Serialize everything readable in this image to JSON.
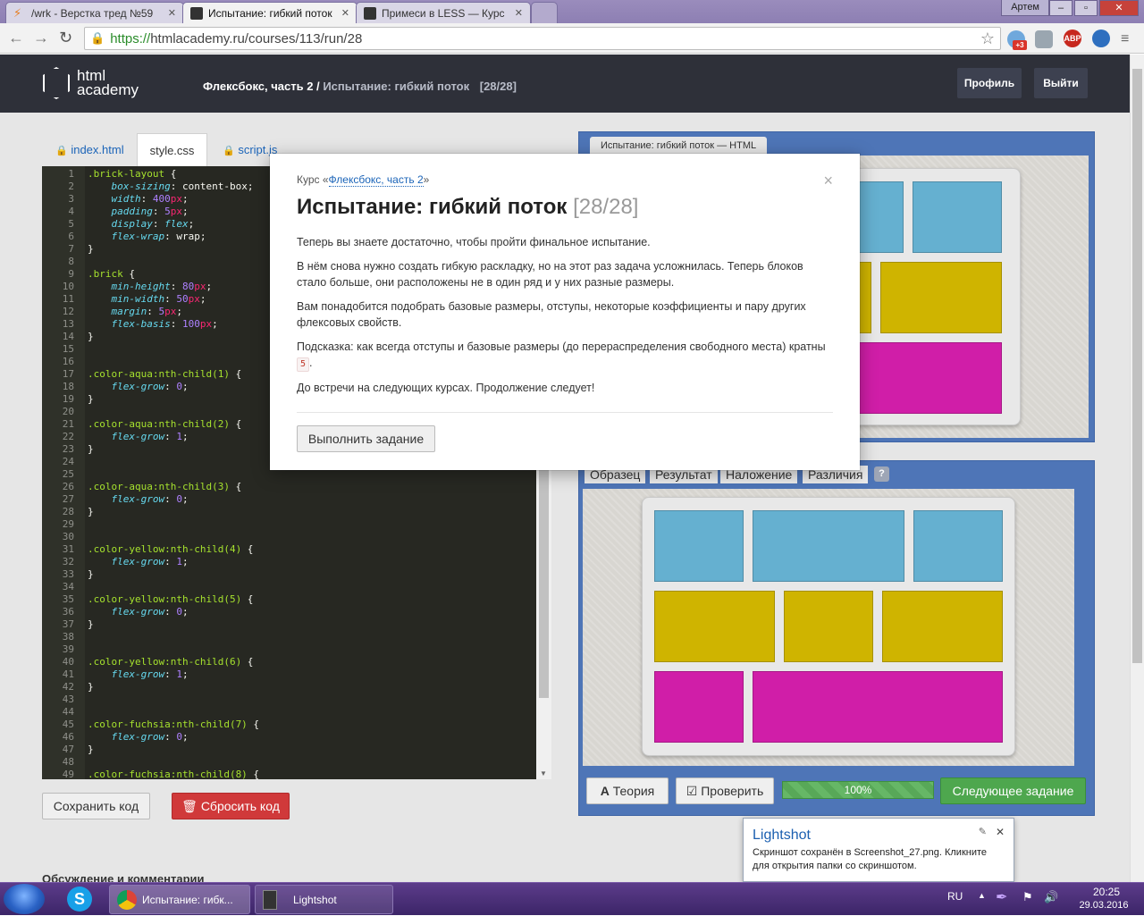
{
  "browser": {
    "tabs": [
      {
        "title": "/wrk - Верстка тред №59",
        "active": false
      },
      {
        "title": "Испытание: гибкий поток",
        "active": true
      },
      {
        "title": "Примеси в LESS — Курс",
        "active": false
      }
    ],
    "user_badge": "Артем",
    "url_https": "https://",
    "url_rest": "htmlacademy.ru/courses/113/run/28",
    "ext_badge": "+3",
    "abp_label": "ABP"
  },
  "site": {
    "logo_line1": "html",
    "logo_line2": "academy",
    "breadcrumb_course": "Флексбокс, часть 2 /",
    "breadcrumb_current": "Испытание: гибкий поток",
    "breadcrumb_count": "[28/28]",
    "profile_label": "Профиль",
    "logout_label": "Выйти"
  },
  "editor": {
    "tabs": [
      {
        "label": "index.html",
        "locked": true,
        "active": false
      },
      {
        "label": "style.css",
        "locked": false,
        "active": true
      },
      {
        "label": "script.js",
        "locked": true,
        "active": false
      }
    ],
    "lines": [
      [
        [
          "sel",
          ".brick-layout"
        ],
        [
          "pun",
          " {"
        ]
      ],
      [
        [
          "pun",
          "    "
        ],
        [
          "prop",
          "box-sizing"
        ],
        [
          "pun",
          ": content-box;"
        ]
      ],
      [
        [
          "pun",
          "    "
        ],
        [
          "prop",
          "width"
        ],
        [
          "pun",
          ": "
        ],
        [
          "num",
          "400"
        ],
        [
          "unit",
          "px"
        ],
        [
          "pun",
          ";"
        ]
      ],
      [
        [
          "pun",
          "    "
        ],
        [
          "prop",
          "padding"
        ],
        [
          "pun",
          ": "
        ],
        [
          "num",
          "5"
        ],
        [
          "unit",
          "px"
        ],
        [
          "pun",
          ";"
        ]
      ],
      [
        [
          "pun",
          "    "
        ],
        [
          "prop",
          "display"
        ],
        [
          "pun",
          ": "
        ],
        [
          "prop",
          "flex"
        ],
        [
          "pun",
          ";"
        ]
      ],
      [
        [
          "pun",
          "    "
        ],
        [
          "prop",
          "flex-wrap"
        ],
        [
          "pun",
          ": wrap;"
        ]
      ],
      [
        [
          "pun",
          "}"
        ]
      ],
      [
        [
          "pun",
          ""
        ]
      ],
      [
        [
          "sel",
          ".brick"
        ],
        [
          "pun",
          " {"
        ]
      ],
      [
        [
          "pun",
          "    "
        ],
        [
          "prop",
          "min-height"
        ],
        [
          "pun",
          ": "
        ],
        [
          "num",
          "80"
        ],
        [
          "unit",
          "px"
        ],
        [
          "pun",
          ";"
        ]
      ],
      [
        [
          "pun",
          "    "
        ],
        [
          "prop",
          "min-width"
        ],
        [
          "pun",
          ": "
        ],
        [
          "num",
          "50"
        ],
        [
          "unit",
          "px"
        ],
        [
          "pun",
          ";"
        ]
      ],
      [
        [
          "pun",
          "    "
        ],
        [
          "prop",
          "margin"
        ],
        [
          "pun",
          ": "
        ],
        [
          "num",
          "5"
        ],
        [
          "unit",
          "px"
        ],
        [
          "pun",
          ";"
        ]
      ],
      [
        [
          "pun",
          "    "
        ],
        [
          "prop",
          "flex-basis"
        ],
        [
          "pun",
          ": "
        ],
        [
          "num",
          "100"
        ],
        [
          "unit",
          "px"
        ],
        [
          "pun",
          ";"
        ]
      ],
      [
        [
          "pun",
          "}"
        ]
      ],
      [
        [
          "pun",
          ""
        ]
      ],
      [
        [
          "pun",
          ""
        ]
      ],
      [
        [
          "sel",
          ".color-aqua:nth-child(1)"
        ],
        [
          "pun",
          " {"
        ]
      ],
      [
        [
          "pun",
          "    "
        ],
        [
          "prop",
          "flex-grow"
        ],
        [
          "pun",
          ": "
        ],
        [
          "num",
          "0"
        ],
        [
          "pun",
          ";"
        ]
      ],
      [
        [
          "pun",
          "}"
        ]
      ],
      [
        [
          "pun",
          ""
        ]
      ],
      [
        [
          "sel",
          ".color-aqua:nth-child(2)"
        ],
        [
          "pun",
          " {"
        ]
      ],
      [
        [
          "pun",
          "    "
        ],
        [
          "prop",
          "flex-grow"
        ],
        [
          "pun",
          ": "
        ],
        [
          "num",
          "1"
        ],
        [
          "pun",
          ";"
        ]
      ],
      [
        [
          "pun",
          "}"
        ]
      ],
      [
        [
          "pun",
          ""
        ]
      ],
      [
        [
          "pun",
          ""
        ]
      ],
      [
        [
          "sel",
          ".color-aqua:nth-child(3)"
        ],
        [
          "pun",
          " {"
        ]
      ],
      [
        [
          "pun",
          "    "
        ],
        [
          "prop",
          "flex-grow"
        ],
        [
          "pun",
          ": "
        ],
        [
          "num",
          "0"
        ],
        [
          "pun",
          ";"
        ]
      ],
      [
        [
          "pun",
          "}"
        ]
      ],
      [
        [
          "pun",
          ""
        ]
      ],
      [
        [
          "pun",
          ""
        ]
      ],
      [
        [
          "sel",
          ".color-yellow:nth-child(4)"
        ],
        [
          "pun",
          " {"
        ]
      ],
      [
        [
          "pun",
          "    "
        ],
        [
          "prop",
          "flex-grow"
        ],
        [
          "pun",
          ": "
        ],
        [
          "num",
          "1"
        ],
        [
          "pun",
          ";"
        ]
      ],
      [
        [
          "pun",
          "}"
        ]
      ],
      [
        [
          "pun",
          ""
        ]
      ],
      [
        [
          "sel",
          ".color-yellow:nth-child(5)"
        ],
        [
          "pun",
          " {"
        ]
      ],
      [
        [
          "pun",
          "    "
        ],
        [
          "prop",
          "flex-grow"
        ],
        [
          "pun",
          ": "
        ],
        [
          "num",
          "0"
        ],
        [
          "pun",
          ";"
        ]
      ],
      [
        [
          "pun",
          "}"
        ]
      ],
      [
        [
          "pun",
          ""
        ]
      ],
      [
        [
          "pun",
          ""
        ]
      ],
      [
        [
          "sel",
          ".color-yellow:nth-child(6)"
        ],
        [
          "pun",
          " {"
        ]
      ],
      [
        [
          "pun",
          "    "
        ],
        [
          "prop",
          "flex-grow"
        ],
        [
          "pun",
          ": "
        ],
        [
          "num",
          "1"
        ],
        [
          "pun",
          ";"
        ]
      ],
      [
        [
          "pun",
          "}"
        ]
      ],
      [
        [
          "pun",
          ""
        ]
      ],
      [
        [
          "pun",
          ""
        ]
      ],
      [
        [
          "sel",
          ".color-fuchsia:nth-child(7)"
        ],
        [
          "pun",
          " {"
        ]
      ],
      [
        [
          "pun",
          "    "
        ],
        [
          "prop",
          "flex-grow"
        ],
        [
          "pun",
          ": "
        ],
        [
          "num",
          "0"
        ],
        [
          "pun",
          ";"
        ]
      ],
      [
        [
          "pun",
          "}"
        ]
      ],
      [
        [
          "pun",
          ""
        ]
      ],
      [
        [
          "sel",
          ".color-fuchsia:nth-child(8)"
        ],
        [
          "pun",
          " {"
        ]
      ]
    ],
    "save_label": "Сохранить код",
    "reset_label": "Сбросить код",
    "discussion_label": "Обсуждение и комментарии"
  },
  "preview": {
    "html_tab": "Испытание: гибкий поток — HTML",
    "mode_tabs": [
      "Образец",
      "Результат",
      "Наложение",
      "Различия"
    ],
    "help_label": "?",
    "theory_label": "Теория",
    "check_label": "Проверить",
    "progress_percent": 100,
    "progress_label": "100%",
    "next_label": "Следующее задание",
    "colors": {
      "aqua": "#65b0d0",
      "yellow": "#cfb400",
      "fuchsia": "#d01ea8"
    }
  },
  "modal": {
    "course_prefix": "Курс «",
    "course_link": "Флексбокс, часть 2",
    "course_suffix": "»",
    "title": "Испытание: гибкий поток",
    "count": "[28/28]",
    "p1": "Теперь вы знаете достаточно, чтобы пройти финальное испытание.",
    "p2": "В нём снова нужно создать гибкую раскладку, но на этот раз задача усложнилась. Теперь блоков стало больше, они расположены не в один ряд и у них разные размеры.",
    "p3": "Вам понадобится подобрать базовые размеры, отступы, некоторые коэффициенты и пару других флексовых свойств.",
    "p4_text": "Подсказка: как всегда отступы и базовые размеры (до перераспределения свободного места) кратны",
    "p4_code": "5",
    "p4_end": ".",
    "p5": "До встречи на следующих курсах. Продолжение следует!",
    "button": "Выполнить задание",
    "close": "×"
  },
  "toast": {
    "title": "Lightshot",
    "body": "Скриншот сохранён в Screenshot_27.png. Кликните для открытия папки со скриншотом."
  },
  "taskbar": {
    "items": [
      "Испытание: гибк...",
      "Lightshot"
    ],
    "lang": "RU",
    "time": "20:25",
    "date": "29.03.2016"
  }
}
